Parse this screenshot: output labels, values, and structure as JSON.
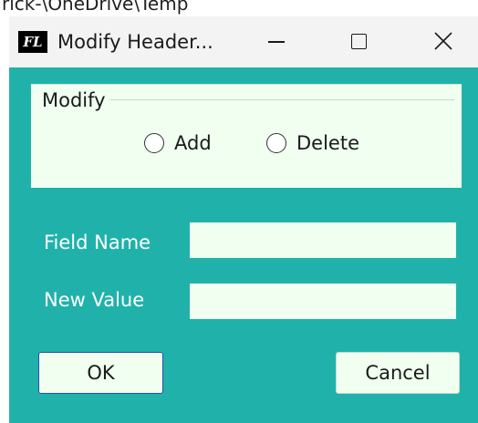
{
  "background": {
    "path_text": "rick-\\OneDrive\\Temp"
  },
  "window": {
    "icon_text": "FL",
    "title": "Modify Header...",
    "accent_color": "#20b2aa",
    "panel_color": "#f0fff0"
  },
  "modify_group": {
    "label": "Modify",
    "options": [
      {
        "label": "Add",
        "selected": false
      },
      {
        "label": "Delete",
        "selected": false
      }
    ]
  },
  "form": {
    "field_name_label": "Field Name",
    "field_name_value": "",
    "new_value_label": "New Value",
    "new_value_value": ""
  },
  "buttons": {
    "ok_label": "OK",
    "cancel_label": "Cancel"
  }
}
